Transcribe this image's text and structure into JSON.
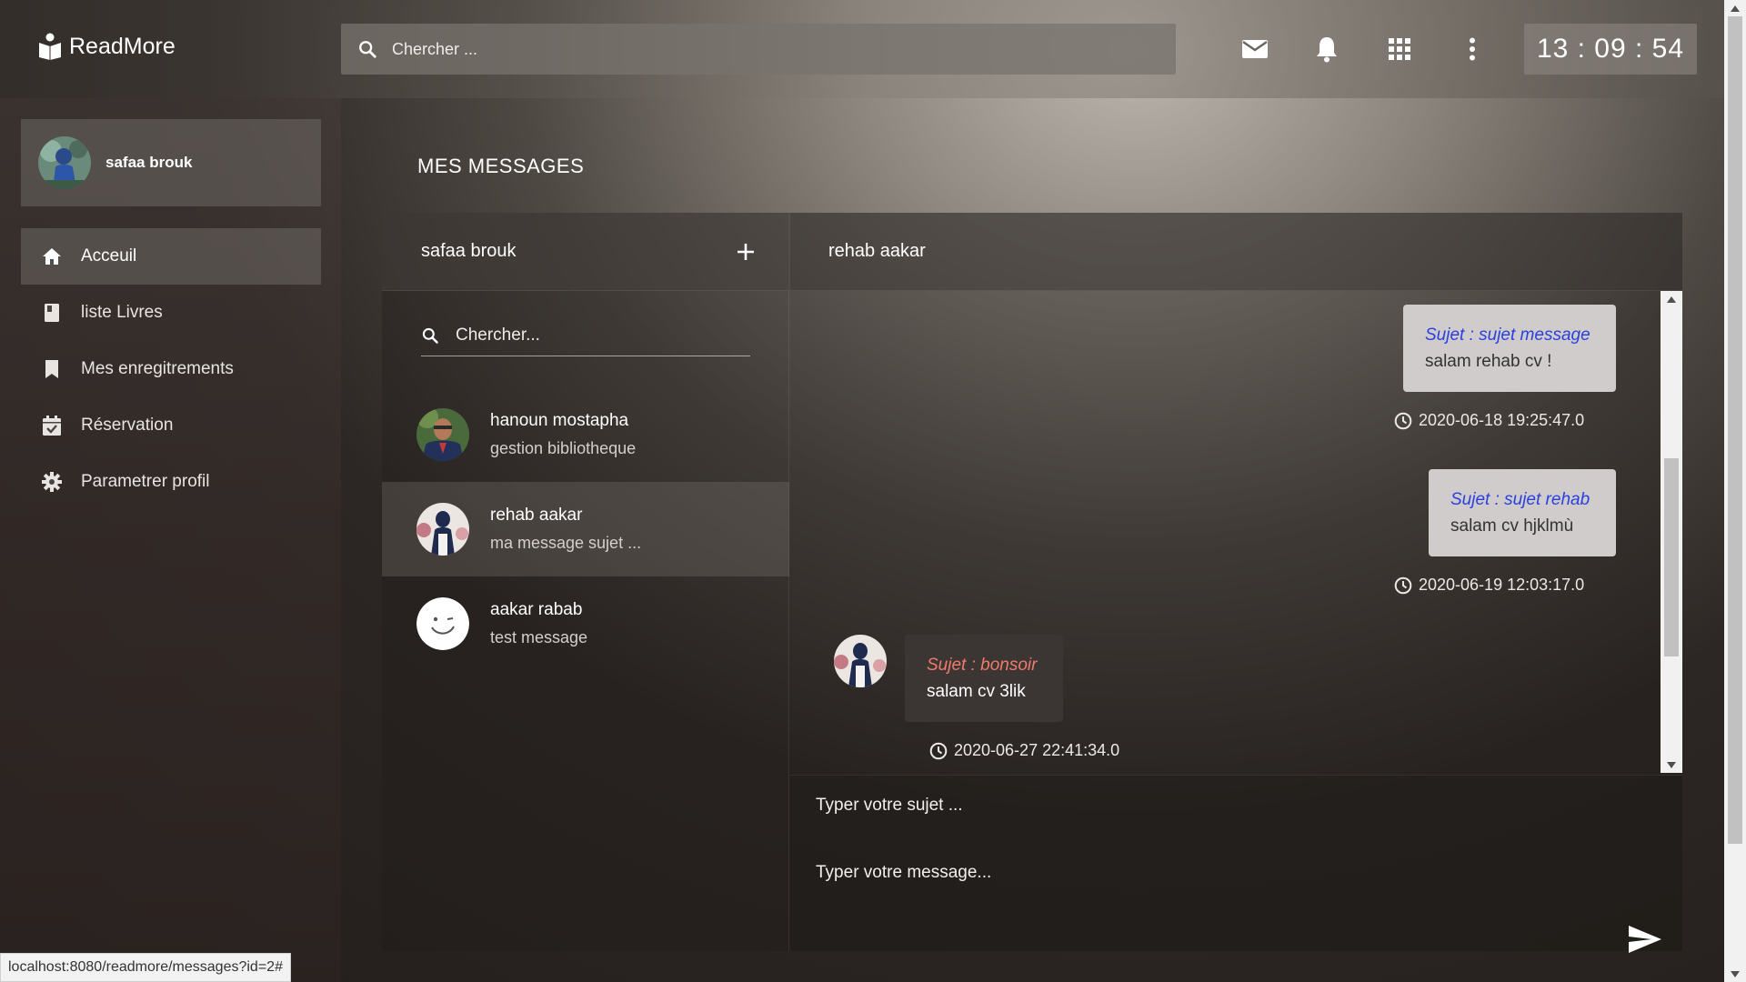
{
  "app": {
    "name": "ReadMore"
  },
  "topbar": {
    "search_placeholder": "Chercher ...",
    "clock": "13 : 09 : 54",
    "icons": [
      "mail-icon",
      "bell-icon",
      "apps-grid-icon",
      "more-vert-icon"
    ]
  },
  "sidebar": {
    "user_name": "safaa brouk",
    "items": [
      {
        "label": "Acceuil",
        "icon": "home-icon",
        "active": true
      },
      {
        "label": "liste Livres",
        "icon": "book-icon",
        "active": false
      },
      {
        "label": "Mes enregitrements",
        "icon": "bookmark-icon",
        "active": false
      },
      {
        "label": "Réservation",
        "icon": "calendar-check-icon",
        "active": false
      },
      {
        "label": "Parametrer profil",
        "icon": "gear-icon",
        "active": false
      }
    ]
  },
  "main": {
    "title": "MES MESSAGES",
    "conversations": {
      "owner": "safaa brouk",
      "search_placeholder": "Chercher...",
      "items": [
        {
          "name": "hanoun mostapha",
          "preview": "gestion bibliotheque",
          "active": false
        },
        {
          "name": "rehab aakar",
          "preview": "ma message sujet ...",
          "active": true
        },
        {
          "name": "aakar rabab",
          "preview": "test message",
          "active": false
        }
      ]
    },
    "chat": {
      "contact": "rehab aakar",
      "messages": [
        {
          "from": "me",
          "subject": "Sujet : sujet message",
          "body": "salam rehab cv !",
          "time": "2020-06-18 19:25:47.0"
        },
        {
          "from": "me",
          "subject": "Sujet : sujet rehab",
          "body": "salam cv hjklmù",
          "time": "2020-06-19 12:03:17.0"
        },
        {
          "from": "them",
          "subject": "Sujet : bonsoir",
          "body": "salam cv 3lik",
          "time": "2020-06-27 22:41:34.0"
        }
      ],
      "subject_placeholder": "Typer votre sujet ...",
      "message_placeholder": "Typer votre message..."
    }
  },
  "status_bar": {
    "url": "localhost:8080/readmore/messages?id=2#"
  },
  "colors": {
    "my_subject": "#2b3fe0",
    "their_subject": "#f07a6a",
    "my_bubble": "#cfcccb",
    "their_bubble": "#3b3634"
  }
}
